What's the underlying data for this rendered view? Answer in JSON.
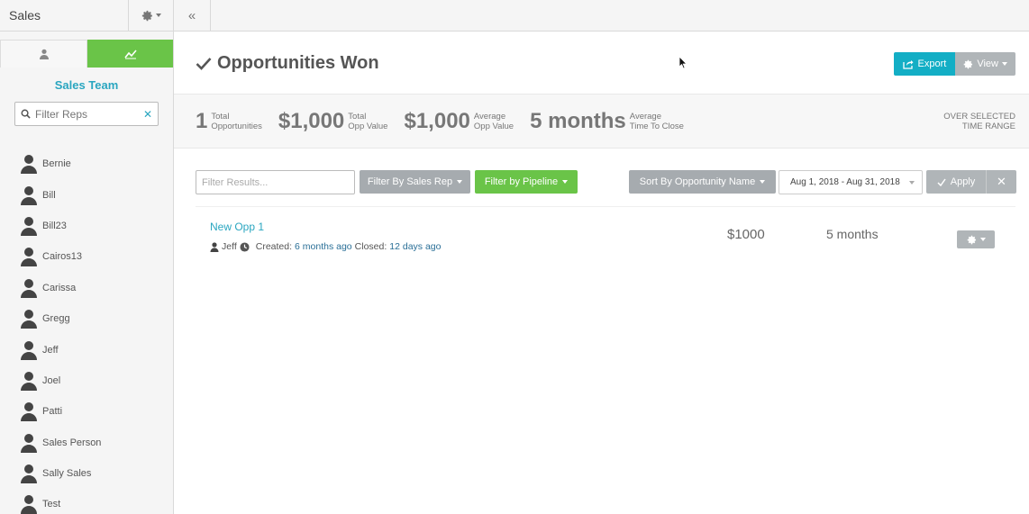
{
  "sidebar": {
    "title": "Sales",
    "team_heading": "Sales Team",
    "filter_placeholder": "Filter Reps",
    "reps": [
      "Bernie",
      "Bill",
      "Bill23",
      "Cairos13",
      "Carissa",
      "Gregg",
      "Jeff",
      "Joel",
      "Patti",
      "Sales Person",
      "Sally Sales",
      "Test"
    ]
  },
  "page": {
    "title": "Opportunities Won",
    "export_label": "Export",
    "view_label": "View"
  },
  "stats": [
    {
      "value": "1",
      "label1": "Total",
      "label2": "Opportunities"
    },
    {
      "value": "$1,000",
      "label1": "Total",
      "label2": "Opp Value"
    },
    {
      "value": "$1,000",
      "label1": "Average",
      "label2": "Opp Value"
    },
    {
      "value": "5 months",
      "label1": "Average",
      "label2": "Time To Close"
    }
  ],
  "range_label1": "OVER SELECTED",
  "range_label2": "TIME RANGE",
  "filters": {
    "results_placeholder": "Filter Results...",
    "sales_rep_label": "Filter By Sales Rep",
    "pipeline_label": "Filter by Pipeline",
    "sort_label": "Sort By Opportunity Name",
    "date_range": "Aug 1, 2018 - Aug 31, 2018",
    "apply_label": "Apply"
  },
  "opportunity": {
    "name": "New Opp 1",
    "owner": "Jeff",
    "created_label": "Created:",
    "created": "6 months ago",
    "closed_label": "Closed:",
    "closed": "12 days ago",
    "value": "$1000",
    "time": "5 months"
  },
  "colors": {
    "accent": "#13aec5",
    "green": "#6ac448",
    "gray_button": "#a6abaf"
  }
}
